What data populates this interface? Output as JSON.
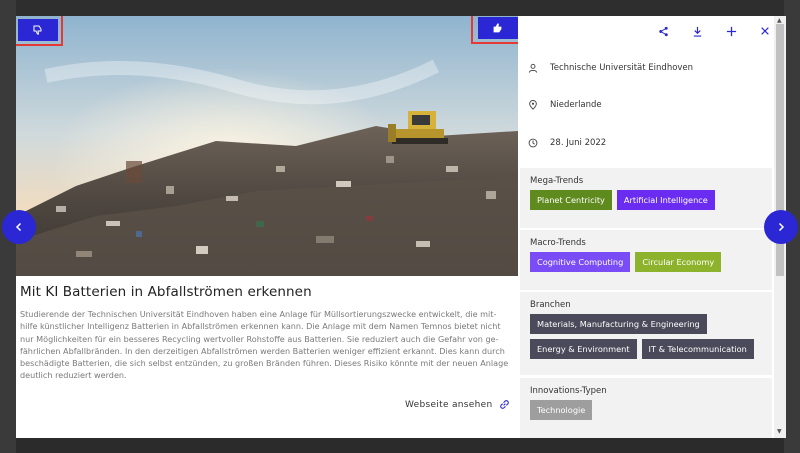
{
  "toolbar": {
    "share_icon": "share-icon",
    "download_icon": "download-icon",
    "add_icon": "plus-icon",
    "close_icon": "close-icon"
  },
  "vote": {
    "down_icon": "thumbs-down-icon",
    "up_icon": "thumbs-up-icon"
  },
  "article": {
    "title": "Mit KI Batterien in Abfallströmen erkennen",
    "body": "Studierende der Technischen Universität Eindhoven haben eine Anlage für Müllsortierungszwecke entwickelt, die mit-hilfe künstlicher Intelligenz Batterien in Abfallströmen erkennen kann. Die Anlage mit dem Namen Temnos bietet nicht nur Möglichkeiten für ein besseres Recycling wertvoller Rohstoffe aus Batterien. Sie reduziert auch die Gefahr von ge-fährlichen Abfallbränden. In den derzeitigen Abfallströmen werden Batterien weniger effizient erkannt. Dies kann durch beschädigte Batterien, die sich selbst entzünden, zu großen Bränden führen. Dieses Risiko könnte mit der neuen Anlage deutlich reduziert werden.",
    "website_label": "Webseite ansehen"
  },
  "meta": {
    "organization": "Technische Universität Eindhoven",
    "country": "Niederlande",
    "date": "28. Juni 2022"
  },
  "sections": {
    "mega": {
      "title": "Mega-Trends",
      "tags": [
        {
          "label": "Planet Centricity",
          "color": "#5f8a1e"
        },
        {
          "label": "Artificial Intelligence",
          "color": "#6a2cf0"
        }
      ]
    },
    "macro": {
      "title": "Macro-Trends",
      "tags": [
        {
          "label": "Cognitive Computing",
          "color": "#7a4cf5"
        },
        {
          "label": "Circular Economy",
          "color": "#8db22b"
        }
      ]
    },
    "branchen": {
      "title": "Branchen",
      "tags": [
        {
          "label": "Materials, Manufacturing & Engineering",
          "color": "#4a4a5a"
        },
        {
          "label": "Energy & Environment",
          "color": "#4a4a5a"
        },
        {
          "label": "IT & Telecommunication",
          "color": "#4a4a5a"
        }
      ]
    },
    "innovation": {
      "title": "Innovations-Typen",
      "tags": [
        {
          "label": "Technologie",
          "color": "#9e9e9e"
        }
      ]
    }
  },
  "colors": {
    "accent": "#2b27d4",
    "highlight": "#e53935"
  }
}
